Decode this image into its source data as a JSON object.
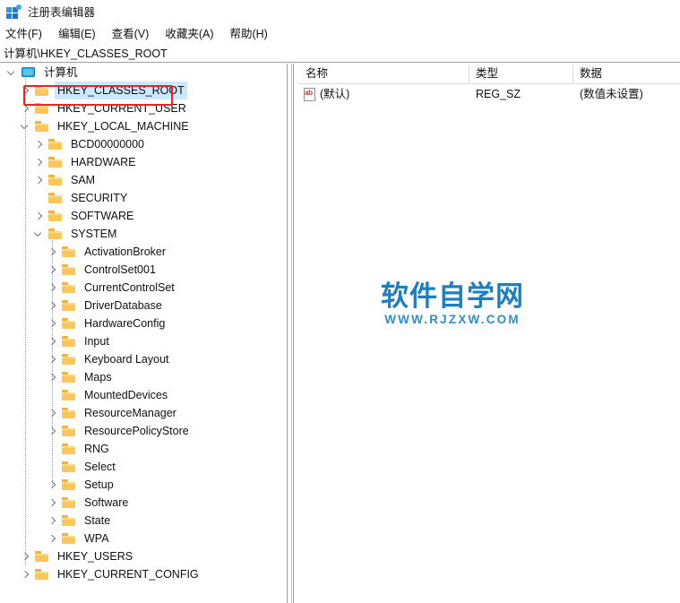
{
  "window": {
    "title": "注册表编辑器",
    "icon": "registry-editor-icon"
  },
  "menubar": {
    "items": [
      {
        "label": "文件(F)",
        "name": "menu-file"
      },
      {
        "label": "编辑(E)",
        "name": "menu-edit"
      },
      {
        "label": "查看(V)",
        "name": "menu-view"
      },
      {
        "label": "收藏夹(A)",
        "name": "menu-favorites"
      },
      {
        "label": "帮助(H)",
        "name": "menu-help"
      }
    ]
  },
  "address": {
    "path": "计算机\\HKEY_CLASSES_ROOT"
  },
  "tree": {
    "nodes": [
      {
        "label": "计算机",
        "depth": 0,
        "icon": "computer-icon",
        "expander": "open",
        "selected": false
      },
      {
        "label": "HKEY_CLASSES_ROOT",
        "depth": 1,
        "icon": "folder-icon",
        "expander": "collapsed",
        "selected": true
      },
      {
        "label": "HKEY_CURRENT_USER",
        "depth": 1,
        "icon": "folder-icon",
        "expander": "collapsed",
        "selected": false
      },
      {
        "label": "HKEY_LOCAL_MACHINE",
        "depth": 1,
        "icon": "folder-icon",
        "expander": "open",
        "selected": false
      },
      {
        "label": "BCD00000000",
        "depth": 2,
        "icon": "folder-icon",
        "expander": "collapsed",
        "selected": false
      },
      {
        "label": "HARDWARE",
        "depth": 2,
        "icon": "folder-icon",
        "expander": "collapsed",
        "selected": false
      },
      {
        "label": "SAM",
        "depth": 2,
        "icon": "folder-icon",
        "expander": "collapsed",
        "selected": false
      },
      {
        "label": "SECURITY",
        "depth": 2,
        "icon": "folder-icon",
        "expander": "none",
        "selected": false
      },
      {
        "label": "SOFTWARE",
        "depth": 2,
        "icon": "folder-icon",
        "expander": "collapsed",
        "selected": false
      },
      {
        "label": "SYSTEM",
        "depth": 2,
        "icon": "folder-icon",
        "expander": "open",
        "selected": false
      },
      {
        "label": "ActivationBroker",
        "depth": 3,
        "icon": "folder-icon",
        "expander": "collapsed",
        "selected": false
      },
      {
        "label": "ControlSet001",
        "depth": 3,
        "icon": "folder-icon",
        "expander": "collapsed",
        "selected": false
      },
      {
        "label": "CurrentControlSet",
        "depth": 3,
        "icon": "folder-icon",
        "expander": "collapsed",
        "selected": false
      },
      {
        "label": "DriverDatabase",
        "depth": 3,
        "icon": "folder-icon",
        "expander": "collapsed",
        "selected": false
      },
      {
        "label": "HardwareConfig",
        "depth": 3,
        "icon": "folder-icon",
        "expander": "collapsed",
        "selected": false
      },
      {
        "label": "Input",
        "depth": 3,
        "icon": "folder-icon",
        "expander": "collapsed",
        "selected": false
      },
      {
        "label": "Keyboard Layout",
        "depth": 3,
        "icon": "folder-icon",
        "expander": "collapsed",
        "selected": false
      },
      {
        "label": "Maps",
        "depth": 3,
        "icon": "folder-icon",
        "expander": "collapsed",
        "selected": false
      },
      {
        "label": "MountedDevices",
        "depth": 3,
        "icon": "folder-icon",
        "expander": "none",
        "selected": false
      },
      {
        "label": "ResourceManager",
        "depth": 3,
        "icon": "folder-icon",
        "expander": "collapsed",
        "selected": false
      },
      {
        "label": "ResourcePolicyStore",
        "depth": 3,
        "icon": "folder-icon",
        "expander": "collapsed",
        "selected": false
      },
      {
        "label": "RNG",
        "depth": 3,
        "icon": "folder-icon",
        "expander": "none",
        "selected": false
      },
      {
        "label": "Select",
        "depth": 3,
        "icon": "folder-icon",
        "expander": "none",
        "selected": false
      },
      {
        "label": "Setup",
        "depth": 3,
        "icon": "folder-icon",
        "expander": "collapsed",
        "selected": false
      },
      {
        "label": "Software",
        "depth": 3,
        "icon": "folder-icon",
        "expander": "collapsed",
        "selected": false
      },
      {
        "label": "State",
        "depth": 3,
        "icon": "folder-icon",
        "expander": "collapsed",
        "selected": false
      },
      {
        "label": "WPA",
        "depth": 3,
        "icon": "folder-icon",
        "expander": "collapsed",
        "selected": false
      },
      {
        "label": "HKEY_USERS",
        "depth": 1,
        "icon": "folder-icon",
        "expander": "collapsed",
        "selected": false
      },
      {
        "label": "HKEY_CURRENT_CONFIG",
        "depth": 1,
        "icon": "folder-icon",
        "expander": "collapsed",
        "selected": false
      }
    ]
  },
  "values": {
    "columns": [
      {
        "label": "名称",
        "name": "column-name"
      },
      {
        "label": "类型",
        "name": "column-type"
      },
      {
        "label": "数据",
        "name": "column-data"
      }
    ],
    "rows": [
      {
        "name": "(默认)",
        "type": "REG_SZ",
        "data": "(数值未设置)",
        "icon": "string-value-icon"
      }
    ]
  },
  "watermark": {
    "cn": "软件自学网",
    "en": "WWW.RJZXW.COM"
  },
  "colors": {
    "selection": "#cce8ff",
    "annotation": "#e8251e",
    "folder": "#fcc65a",
    "watermark": "#1b7fc4"
  }
}
